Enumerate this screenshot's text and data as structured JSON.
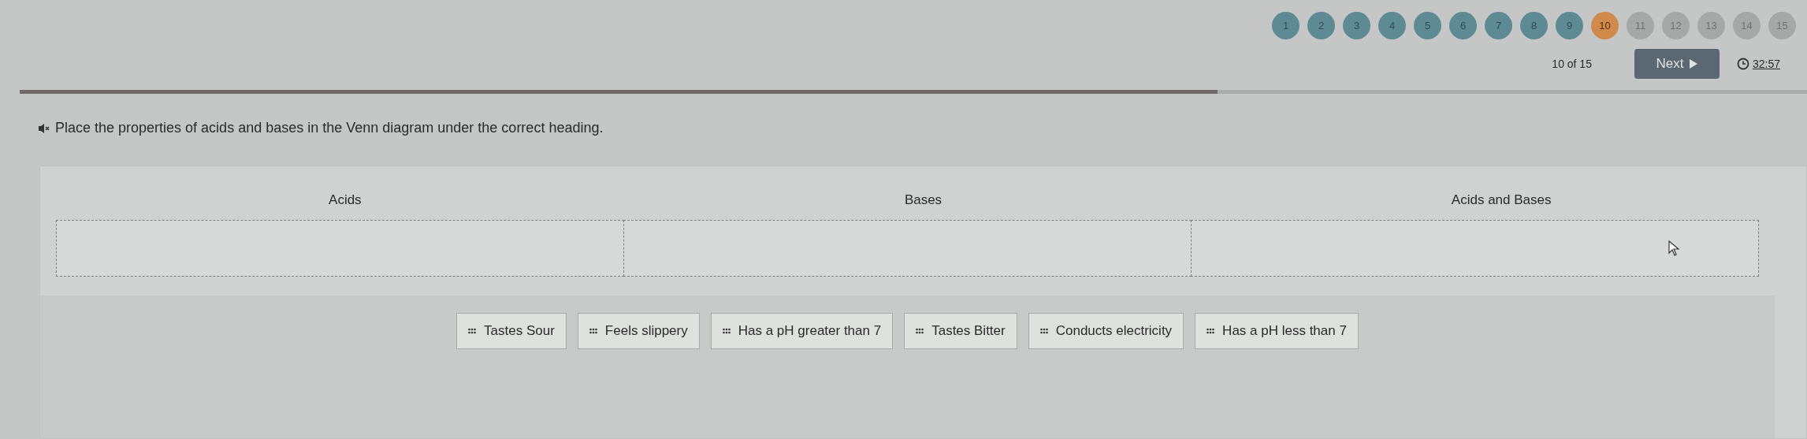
{
  "questions": [
    {
      "label": "1",
      "answered": true,
      "selected": false
    },
    {
      "label": "2",
      "answered": true,
      "selected": false
    },
    {
      "label": "3",
      "answered": true,
      "selected": false
    },
    {
      "label": "4",
      "answered": true,
      "selected": false
    },
    {
      "label": "5",
      "answered": true,
      "selected": false
    },
    {
      "label": "6",
      "answered": true,
      "selected": false
    },
    {
      "label": "7",
      "answered": true,
      "selected": false
    },
    {
      "label": "8",
      "answered": true,
      "selected": false
    },
    {
      "label": "9",
      "answered": true,
      "selected": false
    },
    {
      "label": "10",
      "answered": false,
      "selected": true
    },
    {
      "label": "11",
      "answered": false,
      "selected": false
    },
    {
      "label": "12",
      "answered": false,
      "selected": false
    },
    {
      "label": "13",
      "answered": false,
      "selected": false
    },
    {
      "label": "14",
      "answered": false,
      "selected": false
    },
    {
      "label": "15",
      "answered": false,
      "selected": false
    }
  ],
  "counter": "10 of 15",
  "next_button": "Next",
  "timer": "32:57",
  "progress": {
    "level": 0.67
  },
  "instruction": "Place the properties of acids and bases in the Venn diagram under the correct heading.",
  "categories": [
    "Acids",
    "Bases",
    "Acids and Bases"
  ],
  "answers": [
    "Tastes Sour",
    "Feels slippery",
    "Has a pH greater than 7",
    "Tastes Bitter",
    "Conducts electricity",
    "Has a pH less than 7"
  ]
}
